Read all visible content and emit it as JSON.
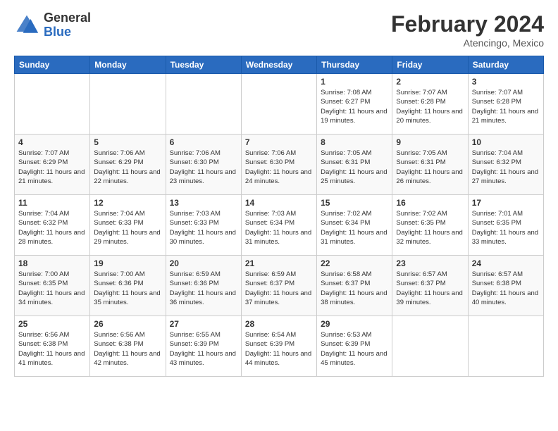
{
  "header": {
    "logo": {
      "general": "General",
      "blue": "Blue"
    },
    "title": "February 2024",
    "location": "Atencingo, Mexico"
  },
  "days_of_week": [
    "Sunday",
    "Monday",
    "Tuesday",
    "Wednesday",
    "Thursday",
    "Friday",
    "Saturday"
  ],
  "weeks": [
    [
      {
        "day": "",
        "info": ""
      },
      {
        "day": "",
        "info": ""
      },
      {
        "day": "",
        "info": ""
      },
      {
        "day": "",
        "info": ""
      },
      {
        "day": "1",
        "info": "Sunrise: 7:08 AM\nSunset: 6:27 PM\nDaylight: 11 hours and 19 minutes."
      },
      {
        "day": "2",
        "info": "Sunrise: 7:07 AM\nSunset: 6:28 PM\nDaylight: 11 hours and 20 minutes."
      },
      {
        "day": "3",
        "info": "Sunrise: 7:07 AM\nSunset: 6:28 PM\nDaylight: 11 hours and 21 minutes."
      }
    ],
    [
      {
        "day": "4",
        "info": "Sunrise: 7:07 AM\nSunset: 6:29 PM\nDaylight: 11 hours and 21 minutes."
      },
      {
        "day": "5",
        "info": "Sunrise: 7:06 AM\nSunset: 6:29 PM\nDaylight: 11 hours and 22 minutes."
      },
      {
        "day": "6",
        "info": "Sunrise: 7:06 AM\nSunset: 6:30 PM\nDaylight: 11 hours and 23 minutes."
      },
      {
        "day": "7",
        "info": "Sunrise: 7:06 AM\nSunset: 6:30 PM\nDaylight: 11 hours and 24 minutes."
      },
      {
        "day": "8",
        "info": "Sunrise: 7:05 AM\nSunset: 6:31 PM\nDaylight: 11 hours and 25 minutes."
      },
      {
        "day": "9",
        "info": "Sunrise: 7:05 AM\nSunset: 6:31 PM\nDaylight: 11 hours and 26 minutes."
      },
      {
        "day": "10",
        "info": "Sunrise: 7:04 AM\nSunset: 6:32 PM\nDaylight: 11 hours and 27 minutes."
      }
    ],
    [
      {
        "day": "11",
        "info": "Sunrise: 7:04 AM\nSunset: 6:32 PM\nDaylight: 11 hours and 28 minutes."
      },
      {
        "day": "12",
        "info": "Sunrise: 7:04 AM\nSunset: 6:33 PM\nDaylight: 11 hours and 29 minutes."
      },
      {
        "day": "13",
        "info": "Sunrise: 7:03 AM\nSunset: 6:33 PM\nDaylight: 11 hours and 30 minutes."
      },
      {
        "day": "14",
        "info": "Sunrise: 7:03 AM\nSunset: 6:34 PM\nDaylight: 11 hours and 31 minutes."
      },
      {
        "day": "15",
        "info": "Sunrise: 7:02 AM\nSunset: 6:34 PM\nDaylight: 11 hours and 31 minutes."
      },
      {
        "day": "16",
        "info": "Sunrise: 7:02 AM\nSunset: 6:35 PM\nDaylight: 11 hours and 32 minutes."
      },
      {
        "day": "17",
        "info": "Sunrise: 7:01 AM\nSunset: 6:35 PM\nDaylight: 11 hours and 33 minutes."
      }
    ],
    [
      {
        "day": "18",
        "info": "Sunrise: 7:00 AM\nSunset: 6:35 PM\nDaylight: 11 hours and 34 minutes."
      },
      {
        "day": "19",
        "info": "Sunrise: 7:00 AM\nSunset: 6:36 PM\nDaylight: 11 hours and 35 minutes."
      },
      {
        "day": "20",
        "info": "Sunrise: 6:59 AM\nSunset: 6:36 PM\nDaylight: 11 hours and 36 minutes."
      },
      {
        "day": "21",
        "info": "Sunrise: 6:59 AM\nSunset: 6:37 PM\nDaylight: 11 hours and 37 minutes."
      },
      {
        "day": "22",
        "info": "Sunrise: 6:58 AM\nSunset: 6:37 PM\nDaylight: 11 hours and 38 minutes."
      },
      {
        "day": "23",
        "info": "Sunrise: 6:57 AM\nSunset: 6:37 PM\nDaylight: 11 hours and 39 minutes."
      },
      {
        "day": "24",
        "info": "Sunrise: 6:57 AM\nSunset: 6:38 PM\nDaylight: 11 hours and 40 minutes."
      }
    ],
    [
      {
        "day": "25",
        "info": "Sunrise: 6:56 AM\nSunset: 6:38 PM\nDaylight: 11 hours and 41 minutes."
      },
      {
        "day": "26",
        "info": "Sunrise: 6:56 AM\nSunset: 6:38 PM\nDaylight: 11 hours and 42 minutes."
      },
      {
        "day": "27",
        "info": "Sunrise: 6:55 AM\nSunset: 6:39 PM\nDaylight: 11 hours and 43 minutes."
      },
      {
        "day": "28",
        "info": "Sunrise: 6:54 AM\nSunset: 6:39 PM\nDaylight: 11 hours and 44 minutes."
      },
      {
        "day": "29",
        "info": "Sunrise: 6:53 AM\nSunset: 6:39 PM\nDaylight: 11 hours and 45 minutes."
      },
      {
        "day": "",
        "info": ""
      },
      {
        "day": "",
        "info": ""
      }
    ]
  ]
}
